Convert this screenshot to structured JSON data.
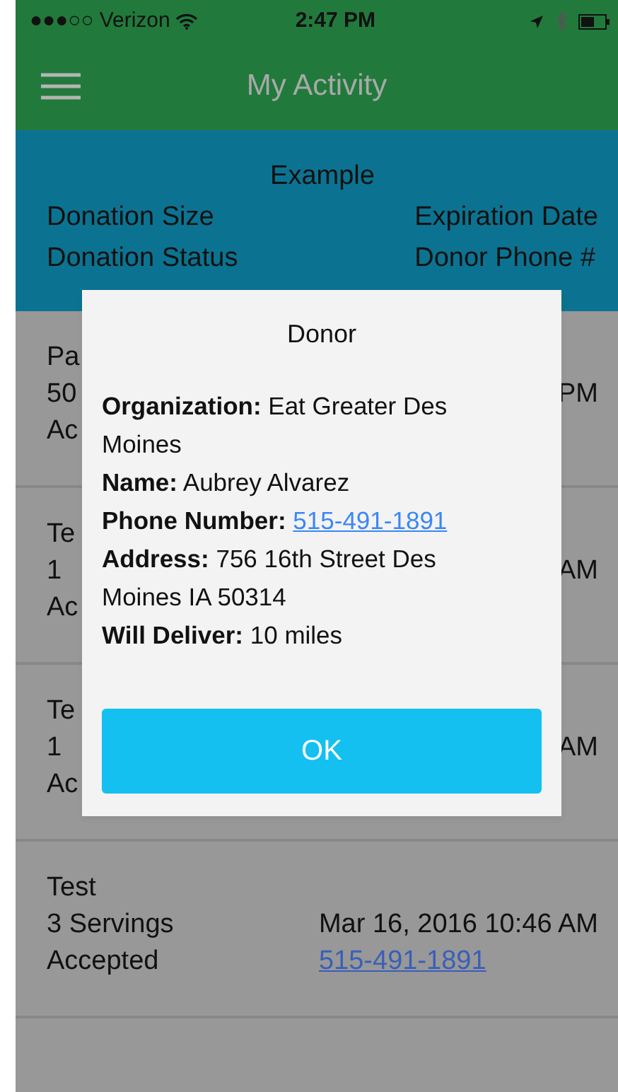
{
  "status_bar": {
    "signal": "●●●○○",
    "carrier": "Verizon",
    "time": "2:47 PM"
  },
  "navbar": {
    "title": "My Activity"
  },
  "header": {
    "title": "Example",
    "left_labels": [
      "Donation Size",
      "Donation Status"
    ],
    "right_labels": [
      "Expiration Date",
      "Donor Phone #"
    ]
  },
  "rows": [
    {
      "title": "Pa",
      "size": "50",
      "status": "Ac",
      "date": "PM"
    },
    {
      "title": "Te",
      "size": "1",
      "status": "Ac",
      "date": "AM"
    },
    {
      "title": "Te",
      "size": "1",
      "status": "Ac",
      "date": "AM"
    },
    {
      "title": "Test",
      "size": "3 Servings",
      "status": "Accepted",
      "date": "Mar 16, 2016 10:46 AM",
      "phone": "515-491-1891"
    }
  ],
  "dialog": {
    "title": "Donor",
    "fields": [
      {
        "label": "Organization:",
        "value": "Eat Greater Des Moines",
        "kind": "text"
      },
      {
        "label": "Name:",
        "value": "Aubrey Alvarez",
        "kind": "text"
      },
      {
        "label": "Phone Number:",
        "value": "515-491-1891",
        "kind": "link"
      },
      {
        "label": "Address:",
        "value": "756 16th Street Des Moines IA 50314",
        "kind": "text"
      },
      {
        "label": "Will Deliver:",
        "value": "10 miles",
        "kind": "text"
      }
    ],
    "button": "OK"
  }
}
